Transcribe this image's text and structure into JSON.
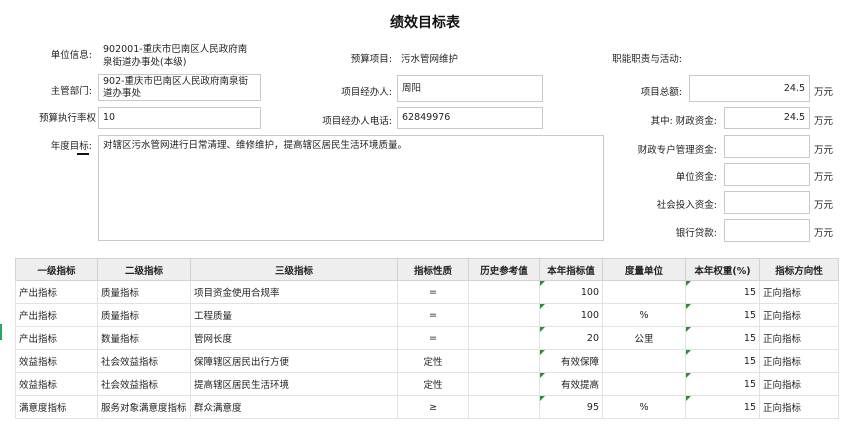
{
  "title": "绩效目标表",
  "form": {
    "unit_label": "单位信息:",
    "unit_value": "902001-重庆市巴南区人民政府南泉街道办事处(本级)",
    "dept_label": "主管部门:",
    "dept_value": "902-重庆市巴南区人民政府南泉街道办事处",
    "budget_rate_label": "预算执行率权",
    "budget_rate_value": "10",
    "annual_goal_label": "年度目标:",
    "annual_goal_value": "对辖区污水管网进行日常清理、维修维护，提高辖区居民生活环境质量。",
    "project_label": "预算项目:",
    "project_value": "污水管网维护",
    "manager_label": "项目经办人:",
    "manager_value": "周阳",
    "phone_label": "项目经办人电话:",
    "phone_value": "62849976",
    "duty_label": "职能职责与活动:",
    "total_label": "项目总额:",
    "total_value": "24.5",
    "fiscal_label": "其中:  财政资金:",
    "fiscal_value": "24.5",
    "special_label": "财政专户管理资金:",
    "special_value": "",
    "unitfund_label": "单位资金:",
    "unitfund_value": "",
    "social_label": "社会投入资金:",
    "social_value": "",
    "loan_label": "银行贷款:",
    "loan_value": "",
    "unit_wan": "万元"
  },
  "table": {
    "headers": [
      "一级指标",
      "二级指标",
      "三级指标",
      "指标性质",
      "历史参考值",
      "本年指标值",
      "度量单位",
      "本年权重(%)",
      "指标方向性"
    ],
    "rows": [
      [
        "产出指标",
        "质量指标",
        "项目资金使用合规率",
        "=",
        "",
        "100",
        "",
        "15",
        "正向指标"
      ],
      [
        "产出指标",
        "质量指标",
        "工程质量",
        "=",
        "",
        "100",
        "%",
        "15",
        "正向指标"
      ],
      [
        "产出指标",
        "数量指标",
        "管网长度",
        "=",
        "",
        "20",
        "公里",
        "15",
        "正向指标"
      ],
      [
        "效益指标",
        "社会效益指标",
        "保障辖区居民出行方便",
        "定性",
        "",
        "有效保障",
        "",
        "15",
        "正向指标"
      ],
      [
        "效益指标",
        "社会效益指标",
        "提高辖区居民生活环境",
        "定性",
        "",
        "有效提高",
        "",
        "15",
        "正向指标"
      ],
      [
        "满意度指标",
        "服务对象满意度指标",
        "群众满意度",
        "≥",
        "",
        "95",
        "%",
        "15",
        "正向指标"
      ]
    ]
  }
}
